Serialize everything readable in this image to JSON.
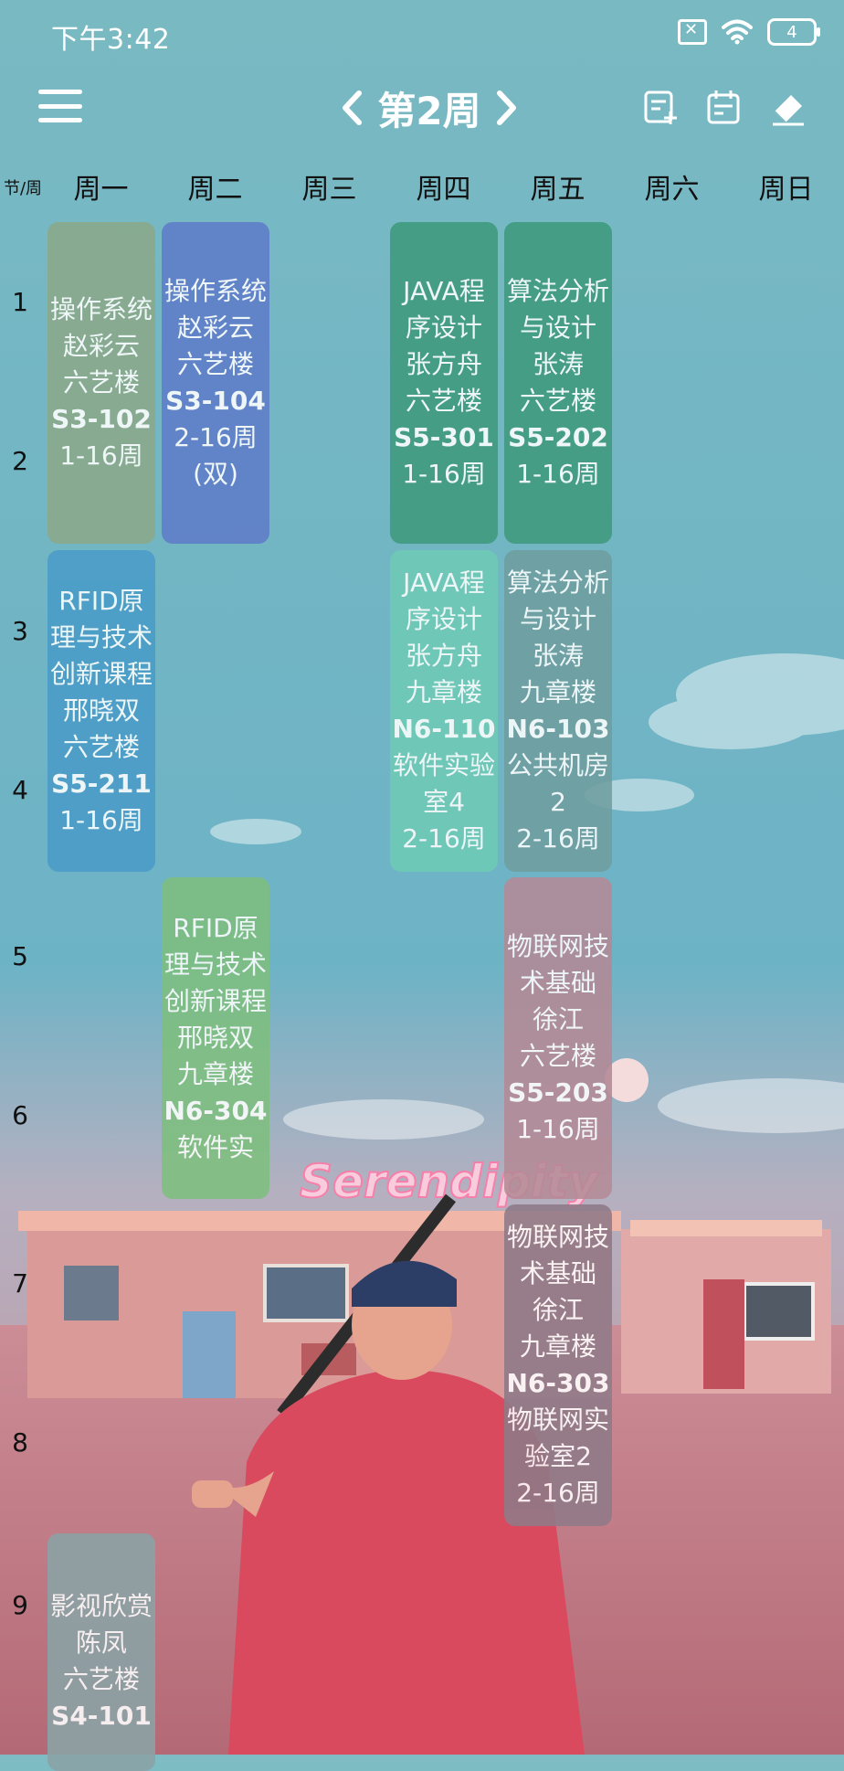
{
  "status_bar": {
    "time": "下午3:42",
    "battery": "4",
    "icons": [
      "sim-off-icon",
      "wifi-icon",
      "battery-icon"
    ]
  },
  "toolbar": {
    "week_title": "第2周",
    "icons": [
      "menu-icon",
      "chevron-left-icon",
      "chevron-right-icon",
      "add-note-icon",
      "calendar-edit-icon",
      "eraser-icon"
    ]
  },
  "header": {
    "corner_label": "节/周",
    "days": [
      "周一",
      "周二",
      "周三",
      "周四",
      "周五",
      "周六",
      "周日"
    ]
  },
  "periods": [
    "1",
    "2",
    "3",
    "4",
    "5",
    "6",
    "7",
    "8",
    "9"
  ],
  "background_text": "Serendipity",
  "courses": [
    {
      "color": "#8aa98a",
      "lines": [
        {
          "text": "操作系统",
          "bold": false
        },
        {
          "text": "赵彩云",
          "bold": false
        },
        {
          "text": "六艺楼",
          "bold": false
        },
        {
          "text": "S3-102",
          "bold": true
        },
        {
          "text": "1-16周",
          "bold": false
        }
      ]
    },
    {
      "color": "#5f7cc8",
      "lines": [
        {
          "text": "操作系统",
          "bold": false
        },
        {
          "text": "赵彩云",
          "bold": false
        },
        {
          "text": "六艺楼",
          "bold": false
        },
        {
          "text": "S3-104",
          "bold": true
        },
        {
          "text": "2-16周(双)",
          "bold": false
        }
      ]
    },
    {
      "color": "#3e9a7c",
      "lines": [
        {
          "text": "JAVA程序设计",
          "bold": false
        },
        {
          "text": "张方舟",
          "bold": false
        },
        {
          "text": "六艺楼",
          "bold": false
        },
        {
          "text": "S5-301",
          "bold": true
        },
        {
          "text": "1-16周",
          "bold": false
        }
      ]
    },
    {
      "color": "#3e9a7c",
      "lines": [
        {
          "text": "算法分析与设计",
          "bold": false
        },
        {
          "text": "张涛",
          "bold": false
        },
        {
          "text": "六艺楼",
          "bold": false
        },
        {
          "text": "S5-202",
          "bold": true
        },
        {
          "text": "1-16周",
          "bold": false
        }
      ]
    },
    {
      "color": "#4a9cc8",
      "lines": [
        {
          "text": "RFID原理与技术创新课程",
          "bold": false
        },
        {
          "text": "邢晓双",
          "bold": false
        },
        {
          "text": "六艺楼",
          "bold": false
        },
        {
          "text": "S5-211",
          "bold": true
        },
        {
          "text": "1-16周",
          "bold": false
        }
      ]
    },
    {
      "color": "#6fcbb6",
      "lines": [
        {
          "text": "JAVA程序设计",
          "bold": false
        },
        {
          "text": "张方舟",
          "bold": false
        },
        {
          "text": "九章楼",
          "bold": false
        },
        {
          "text": "N6-110",
          "bold": true
        },
        {
          "text": "软件实验室4",
          "bold": false
        },
        {
          "text": "2-16周",
          "bold": false
        }
      ]
    },
    {
      "color": "#6f9ea0",
      "lines": [
        {
          "text": "算法分析与设计",
          "bold": false
        },
        {
          "text": "张涛",
          "bold": false
        },
        {
          "text": "九章楼",
          "bold": false
        },
        {
          "text": "N6-103",
          "bold": true
        },
        {
          "text": "公共机房2",
          "bold": false
        },
        {
          "text": "2-16周",
          "bold": false
        }
      ]
    },
    {
      "color": "#7fbf7f",
      "lines": [
        {
          "text": "RFID原理与技术创新课程",
          "bold": false
        },
        {
          "text": "邢晓双",
          "bold": false
        },
        {
          "text": "九章楼",
          "bold": false
        },
        {
          "text": "N6-304",
          "bold": true
        },
        {
          "text": "软件实",
          "bold": false
        }
      ]
    },
    {
      "color": "#b48a96",
      "lines": [
        {
          "text": "物联网技术基础",
          "bold": false
        },
        {
          "text": "徐江",
          "bold": false
        },
        {
          "text": "六艺楼",
          "bold": false
        },
        {
          "text": "S5-203",
          "bold": true
        },
        {
          "text": "1-16周",
          "bold": false
        }
      ]
    },
    {
      "color": "#8f7a88",
      "lines": [
        {
          "text": "物联网技术基础",
          "bold": false
        },
        {
          "text": "徐江",
          "bold": false
        },
        {
          "text": "九章楼",
          "bold": false
        },
        {
          "text": "N6-303",
          "bold": true
        },
        {
          "text": "物联网实验室2",
          "bold": false
        },
        {
          "text": "2-16周",
          "bold": false
        }
      ]
    },
    {
      "color": "#8aa3a6",
      "lines": [
        {
          "text": "影视欣赏",
          "bold": false
        },
        {
          "text": "陈凤",
          "bold": false
        },
        {
          "text": "六艺楼",
          "bold": false
        },
        {
          "text": "S4-101",
          "bold": true
        }
      ]
    }
  ]
}
